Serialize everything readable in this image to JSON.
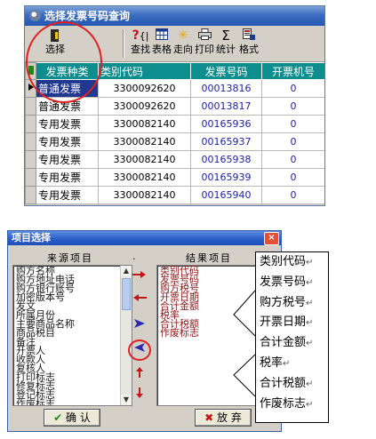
{
  "window1": {
    "title": "选择发票号码查询",
    "toolbar": {
      "select": "选择",
      "find": "查找",
      "table": "表格",
      "direction": "走向",
      "print": "打印",
      "stats": "统计",
      "format": "格式"
    },
    "grid": {
      "columns": [
        "发票种类",
        "类别代码",
        "发票号码",
        "开票机号"
      ],
      "rows": [
        {
          "type": "普通发票",
          "code": "3300092620",
          "number": "00013816",
          "machine": "0"
        },
        {
          "type": "普通发票",
          "code": "3300092620",
          "number": "00013817",
          "machine": "0"
        },
        {
          "type": "专用发票",
          "code": "3300082140",
          "number": "00165936",
          "machine": "0"
        },
        {
          "type": "专用发票",
          "code": "3300082140",
          "number": "00165937",
          "machine": "0"
        },
        {
          "type": "专用发票",
          "code": "3300082140",
          "number": "00165938",
          "machine": "0"
        },
        {
          "type": "专用发票",
          "code": "3300082140",
          "number": "00165939",
          "machine": "0"
        },
        {
          "type": "专用发票",
          "code": "3300082140",
          "number": "00165940",
          "machine": "0"
        }
      ]
    }
  },
  "window2": {
    "title": "项目选择",
    "close_label": "×",
    "source_header": "来源项目",
    "result_header": "结果项目",
    "source_items": [
      "购方名称",
      "购方地址电话",
      "购方银行账号",
      "加密版本号",
      "发文",
      "所属月份",
      "主要商品名称",
      "商品税目",
      "备注",
      "开票人",
      "收款人",
      "复核人",
      "打印标志",
      "修复标志",
      "登记标志",
      "作废标志"
    ],
    "result_items": [
      "类别代码",
      "发票号码",
      "购方税号",
      "开票日期",
      "合计金额",
      "税率",
      "合计税额",
      "作废标志"
    ],
    "ok_label": "确 认",
    "cancel_label": "放 弃"
  },
  "callout": {
    "lines": [
      "类别代码",
      "发票号码",
      "购方税号",
      "开票日期",
      "合计金额",
      "税率",
      "合计税额",
      "作废标志"
    ],
    "mark": "↵"
  },
  "colors": {
    "grid_header": "#0d8d8d",
    "selection": "#203890",
    "number_text": "#1e22a8",
    "annotation_red": "#e02020"
  }
}
